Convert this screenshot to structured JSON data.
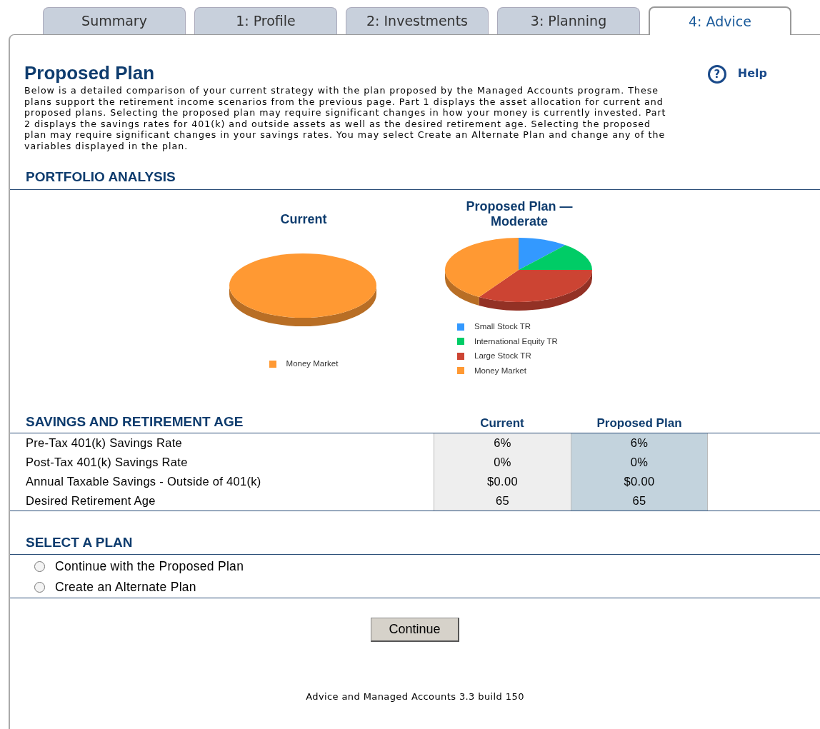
{
  "tabs": [
    {
      "label": "Summary",
      "selected": false
    },
    {
      "label": "1: Profile",
      "selected": false
    },
    {
      "label": "2: Investments",
      "selected": false
    },
    {
      "label": "3: Planning",
      "selected": false
    },
    {
      "label": "4: Advice",
      "selected": true
    }
  ],
  "title": "Proposed Plan",
  "help": {
    "icon": "?",
    "label": "Help"
  },
  "description": "Below is a detailed comparison of your current strategy with the plan proposed by the Managed Accounts program. These plans support the retirement income scenarios from the previous page. Part 1 displays the asset allocation for current and proposed plans. Selecting the proposed plan may require significant changes in how your money is currently invested. Part 2 displays the savings rates for 401(k) and outside assets as well as the desired retirement age. Selecting the proposed plan may require significant changes in your savings rates. You may select Create an Alternate Plan and change any of the variables displayed in the plan.",
  "portfolio": {
    "heading": "PORTFOLIO ANALYSIS",
    "charts": [
      {
        "title": "Current",
        "legend": [
          {
            "label": "Money Market",
            "color": "#ff9933"
          }
        ]
      },
      {
        "title": "Proposed Plan — Moderate",
        "legend": [
          {
            "label": "Small Stock TR",
            "color": "#3399ff"
          },
          {
            "label": "International Equity TR",
            "color": "#00cc66"
          },
          {
            "label": "Large Stock TR",
            "color": "#cc4433"
          },
          {
            "label": "Money Market",
            "color": "#ff9933"
          }
        ]
      }
    ]
  },
  "savings": {
    "heading": "SAVINGS AND RETIREMENT AGE",
    "columns": [
      "Current",
      "Proposed Plan"
    ],
    "rows": [
      {
        "label": "Pre-Tax 401(k) Savings Rate",
        "current": "6%",
        "proposed": "6%"
      },
      {
        "label": "Post-Tax 401(k) Savings Rate",
        "current": "0%",
        "proposed": "0%"
      },
      {
        "label": "Annual Taxable Savings - Outside of 401(k)",
        "current": "$0.00",
        "proposed": "$0.00"
      },
      {
        "label": "Desired Retirement Age",
        "current": "65",
        "proposed": "65"
      }
    ]
  },
  "select_plan": {
    "heading": "SELECT A PLAN",
    "options": [
      {
        "label": "Continue with the Proposed Plan",
        "selected": false
      },
      {
        "label": "Create an Alternate Plan",
        "selected": false
      }
    ]
  },
  "button": "Continue",
  "footer": "Advice and Managed Accounts 3.3 build 150"
}
